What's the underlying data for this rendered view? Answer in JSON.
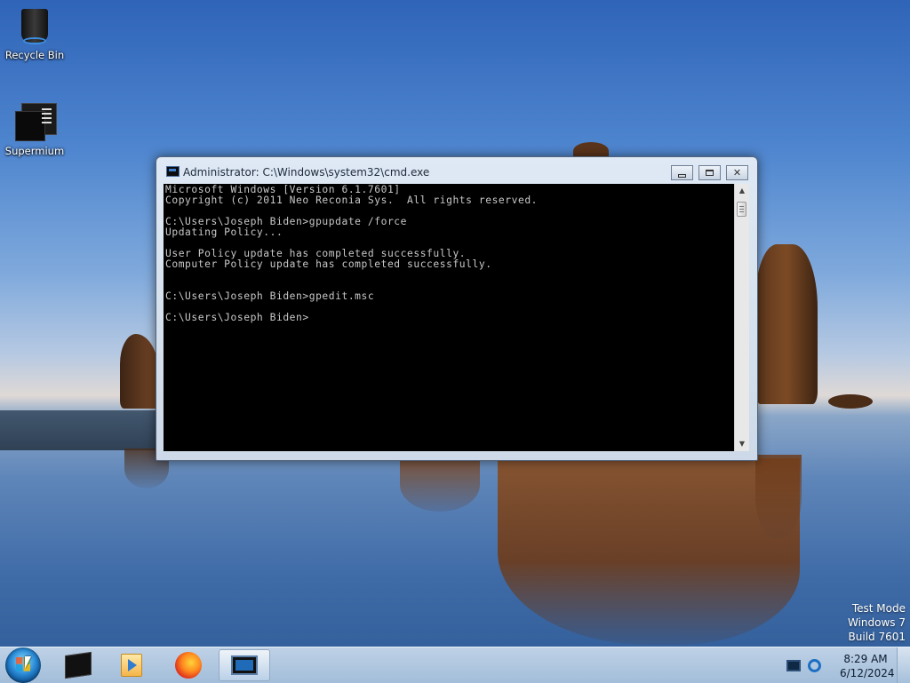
{
  "desktop": {
    "icons": [
      {
        "label": "Recycle Bin",
        "icon": "recycle-bin-icon"
      },
      {
        "label": "Supermium",
        "icon": "supermium-icon"
      }
    ],
    "watermark": [
      "Test Mode",
      "Windows 7",
      "Build 7601"
    ]
  },
  "window": {
    "title": "Administrator: C:\\Windows\\system32\\cmd.exe",
    "icon": "cmd-icon",
    "console_bg": "#000000",
    "console_fg": "#c8c8c8",
    "lines": [
      "Microsoft Windows [Version 6.1.7601]",
      "Copyright (c) 2011 Neo Reconia Sys.  All rights reserved.",
      "",
      "C:\\Users\\Joseph Biden>gpupdate /force",
      "Updating Policy...",
      "",
      "User Policy update has completed successfully.",
      "Computer Policy update has completed successfully.",
      "",
      "",
      "C:\\Users\\Joseph Biden>gpedit.msc",
      "",
      "C:\\Users\\Joseph Biden>"
    ],
    "buttons": [
      "minimize-icon",
      "maximize-icon",
      "close-icon"
    ]
  },
  "taskbar": {
    "start": "start-orb-icon",
    "pinned": [
      "supermium-icon",
      "media-player-icon",
      "firefox-icon",
      "cmd-icon"
    ],
    "active": "cmd-icon",
    "tray": [
      "monitor-icon",
      "ie-icon"
    ],
    "time": "8:29 AM",
    "date": "6/12/2024"
  }
}
